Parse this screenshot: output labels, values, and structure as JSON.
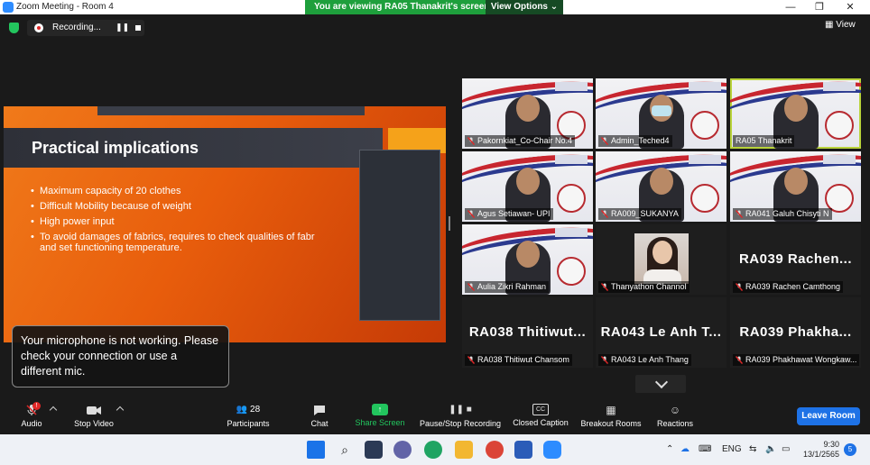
{
  "titlebar": {
    "title": "Zoom Meeting - Room 4",
    "viewing_banner": "You are viewing RA05 Thanakrit's screen",
    "view_options": "View Options ⌄"
  },
  "top": {
    "recording_label": "Recording...",
    "view_label": "View"
  },
  "slide": {
    "title": "Practical implications",
    "bullets": [
      "Maximum capacity of 20 clothes",
      "Difficult Mobility because of weight",
      "High power input",
      "To avoid damages of fabrics, requires to check qualities of fabr",
      "and set functioning temperature."
    ]
  },
  "mic_toast": {
    "text": "Your microphone is not working. Please check your connection or use a different mic."
  },
  "gallery": {
    "tiles": [
      {
        "name": "Pakornkiat_Co-Chair No.4",
        "type": "video",
        "muted": true
      },
      {
        "name": "Admin_Teched4",
        "type": "video",
        "muted": true
      },
      {
        "name": "RA05 Thanakrit",
        "type": "video",
        "muted": false,
        "active": true
      },
      {
        "name": "Agus Setiawan- UPI",
        "type": "video",
        "muted": true
      },
      {
        "name": "RA009_SUKANYA",
        "type": "video",
        "muted": true
      },
      {
        "name": "RA041 Galuh Chisyti N",
        "type": "video",
        "muted": true
      },
      {
        "name": "Aulia Zikri Rahman",
        "type": "video",
        "muted": true
      },
      {
        "name": "Thanyathon Channol",
        "type": "photo",
        "muted": true
      },
      {
        "name": "RA039 Rachen Camthong",
        "type": "name",
        "big": "RA039  Rachen...",
        "muted": true
      },
      {
        "name": "RA038 Thitiwut Chansom",
        "type": "name",
        "big": "RA038  Thitiwut...",
        "muted": true
      },
      {
        "name": "RA043 Le Anh Thang",
        "type": "name",
        "big": "RA043  Le Anh T...",
        "muted": true
      },
      {
        "name": "RA039 Phakhawat Wongkaw...",
        "type": "name",
        "big": "RA039  Phakha...",
        "muted": true
      }
    ]
  },
  "toolbar": {
    "audio": "Audio",
    "stop_video": "Stop Video",
    "participants": "Participants",
    "participants_count": "28",
    "chat": "Chat",
    "share_screen": "Share Screen",
    "pause_stop_recording": "Pause/Stop Recording",
    "closed_caption": "Closed Caption",
    "breakout_rooms": "Breakout Rooms",
    "reactions": "Reactions",
    "leave_room": "Leave Room"
  },
  "taskbar": {
    "lang": "ENG",
    "time": "9:30",
    "date": "13/1/2565",
    "notification_count": "5"
  },
  "colors": {
    "green_accent": "#22c55e",
    "zoom_blue": "#1e72e6",
    "active_outline": "#b9d33a"
  }
}
